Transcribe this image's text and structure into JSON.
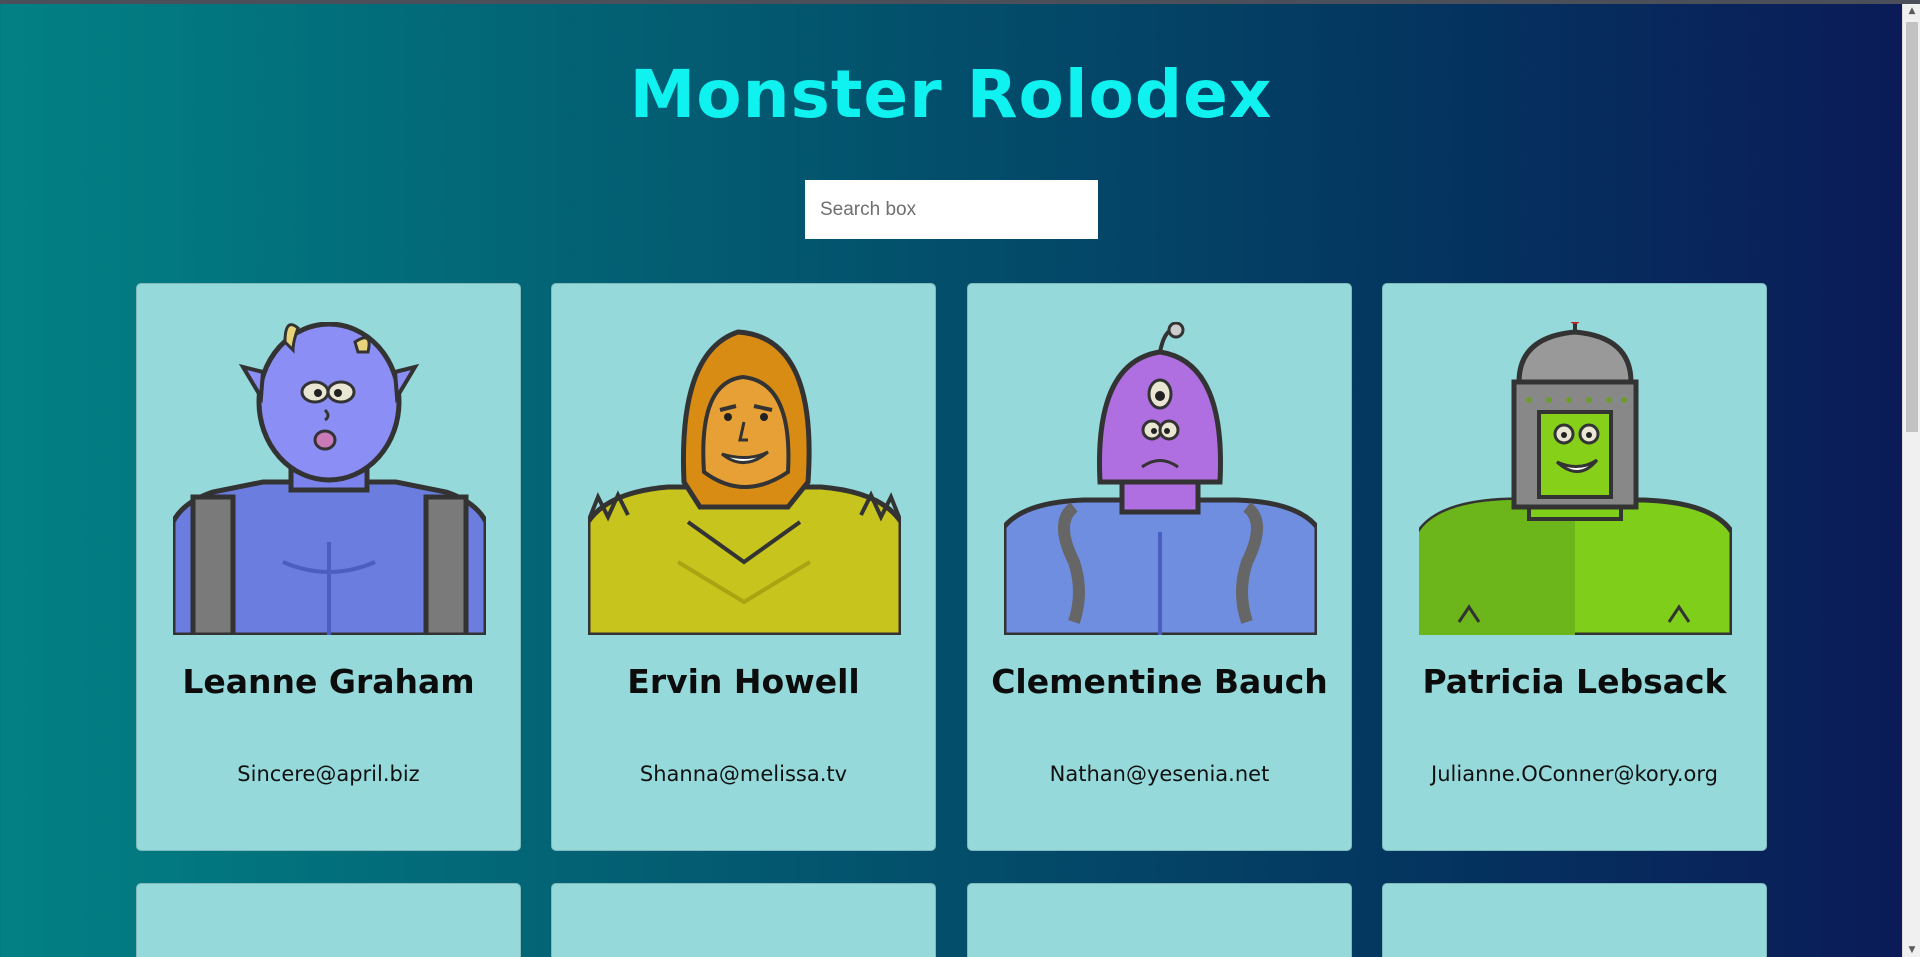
{
  "title": "Monster Rolodex",
  "search": {
    "placeholder": "Search box",
    "value": ""
  },
  "monsters": [
    {
      "name": "Leanne Graham",
      "email": "Sincere@april.biz",
      "skin": "#8b8ff5",
      "suit": "#6b7ee0",
      "style": "horned"
    },
    {
      "name": "Ervin Howell",
      "email": "Shanna@melissa.tv",
      "skin": "#d98c14",
      "suit": "#c8c41e",
      "style": "hooded"
    },
    {
      "name": "Clementine Bauch",
      "email": "Nathan@yesenia.net",
      "skin": "#b06fe0",
      "suit": "#6f8ee0",
      "style": "cyclops"
    },
    {
      "name": "Patricia Lebsack",
      "email": "Julianne.OConner@kory.org",
      "skin": "#86d01a",
      "suit": "#7fcf1a",
      "style": "robot"
    }
  ],
  "colors": {
    "accent": "#0ff2f0",
    "card": "#95d9da"
  }
}
